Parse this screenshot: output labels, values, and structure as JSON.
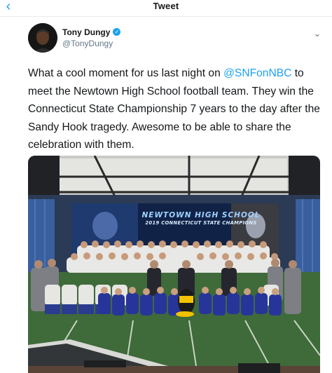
{
  "topbar": {
    "title": "Tweet",
    "back_icon": "back-arrow-icon"
  },
  "tweet": {
    "author": {
      "name": "Tony Dungy",
      "handle": "@TonyDungy",
      "verified_icon": "verified-badge-icon"
    },
    "more_icon": "chevron-down-icon",
    "text_before": "What a cool moment for us last night on ",
    "mention": "@SNFonNBC",
    "text_after": " to meet the Newtown High School football team.  They win the Connecticut State Championship 7 years to the day after the Sandy Hook tragedy. Awesome to be able to share the celebration with them."
  },
  "media": {
    "banner_line1": "NEWTOWN HIGH SCHOOL",
    "banner_line2": "2019 CONNECTICUT STATE CHAMPIONS"
  },
  "colors": {
    "accent": "#1da1f2",
    "text": "#14171a",
    "secondary_text": "#657786"
  }
}
